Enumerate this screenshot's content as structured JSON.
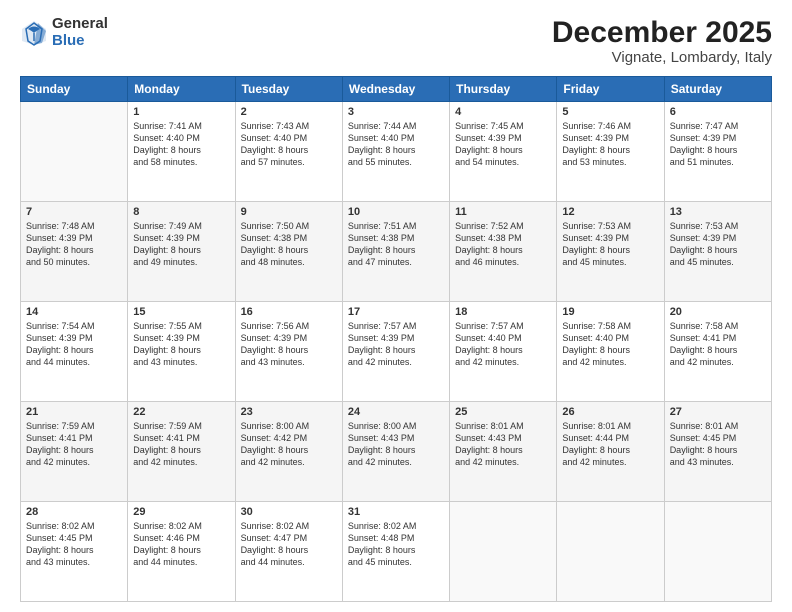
{
  "logo": {
    "general": "General",
    "blue": "Blue"
  },
  "header": {
    "title": "December 2025",
    "subtitle": "Vignate, Lombardy, Italy"
  },
  "weekdays": [
    "Sunday",
    "Monday",
    "Tuesday",
    "Wednesday",
    "Thursday",
    "Friday",
    "Saturday"
  ],
  "weeks": [
    [
      {
        "day": "",
        "info": ""
      },
      {
        "day": "1",
        "info": "Sunrise: 7:41 AM\nSunset: 4:40 PM\nDaylight: 8 hours\nand 58 minutes."
      },
      {
        "day": "2",
        "info": "Sunrise: 7:43 AM\nSunset: 4:40 PM\nDaylight: 8 hours\nand 57 minutes."
      },
      {
        "day": "3",
        "info": "Sunrise: 7:44 AM\nSunset: 4:40 PM\nDaylight: 8 hours\nand 55 minutes."
      },
      {
        "day": "4",
        "info": "Sunrise: 7:45 AM\nSunset: 4:39 PM\nDaylight: 8 hours\nand 54 minutes."
      },
      {
        "day": "5",
        "info": "Sunrise: 7:46 AM\nSunset: 4:39 PM\nDaylight: 8 hours\nand 53 minutes."
      },
      {
        "day": "6",
        "info": "Sunrise: 7:47 AM\nSunset: 4:39 PM\nDaylight: 8 hours\nand 51 minutes."
      }
    ],
    [
      {
        "day": "7",
        "info": "Sunrise: 7:48 AM\nSunset: 4:39 PM\nDaylight: 8 hours\nand 50 minutes."
      },
      {
        "day": "8",
        "info": "Sunrise: 7:49 AM\nSunset: 4:39 PM\nDaylight: 8 hours\nand 49 minutes."
      },
      {
        "day": "9",
        "info": "Sunrise: 7:50 AM\nSunset: 4:38 PM\nDaylight: 8 hours\nand 48 minutes."
      },
      {
        "day": "10",
        "info": "Sunrise: 7:51 AM\nSunset: 4:38 PM\nDaylight: 8 hours\nand 47 minutes."
      },
      {
        "day": "11",
        "info": "Sunrise: 7:52 AM\nSunset: 4:38 PM\nDaylight: 8 hours\nand 46 minutes."
      },
      {
        "day": "12",
        "info": "Sunrise: 7:53 AM\nSunset: 4:39 PM\nDaylight: 8 hours\nand 45 minutes."
      },
      {
        "day": "13",
        "info": "Sunrise: 7:53 AM\nSunset: 4:39 PM\nDaylight: 8 hours\nand 45 minutes."
      }
    ],
    [
      {
        "day": "14",
        "info": "Sunrise: 7:54 AM\nSunset: 4:39 PM\nDaylight: 8 hours\nand 44 minutes."
      },
      {
        "day": "15",
        "info": "Sunrise: 7:55 AM\nSunset: 4:39 PM\nDaylight: 8 hours\nand 43 minutes."
      },
      {
        "day": "16",
        "info": "Sunrise: 7:56 AM\nSunset: 4:39 PM\nDaylight: 8 hours\nand 43 minutes."
      },
      {
        "day": "17",
        "info": "Sunrise: 7:57 AM\nSunset: 4:39 PM\nDaylight: 8 hours\nand 42 minutes."
      },
      {
        "day": "18",
        "info": "Sunrise: 7:57 AM\nSunset: 4:40 PM\nDaylight: 8 hours\nand 42 minutes."
      },
      {
        "day": "19",
        "info": "Sunrise: 7:58 AM\nSunset: 4:40 PM\nDaylight: 8 hours\nand 42 minutes."
      },
      {
        "day": "20",
        "info": "Sunrise: 7:58 AM\nSunset: 4:41 PM\nDaylight: 8 hours\nand 42 minutes."
      }
    ],
    [
      {
        "day": "21",
        "info": "Sunrise: 7:59 AM\nSunset: 4:41 PM\nDaylight: 8 hours\nand 42 minutes."
      },
      {
        "day": "22",
        "info": "Sunrise: 7:59 AM\nSunset: 4:41 PM\nDaylight: 8 hours\nand 42 minutes."
      },
      {
        "day": "23",
        "info": "Sunrise: 8:00 AM\nSunset: 4:42 PM\nDaylight: 8 hours\nand 42 minutes."
      },
      {
        "day": "24",
        "info": "Sunrise: 8:00 AM\nSunset: 4:43 PM\nDaylight: 8 hours\nand 42 minutes."
      },
      {
        "day": "25",
        "info": "Sunrise: 8:01 AM\nSunset: 4:43 PM\nDaylight: 8 hours\nand 42 minutes."
      },
      {
        "day": "26",
        "info": "Sunrise: 8:01 AM\nSunset: 4:44 PM\nDaylight: 8 hours\nand 42 minutes."
      },
      {
        "day": "27",
        "info": "Sunrise: 8:01 AM\nSunset: 4:45 PM\nDaylight: 8 hours\nand 43 minutes."
      }
    ],
    [
      {
        "day": "28",
        "info": "Sunrise: 8:02 AM\nSunset: 4:45 PM\nDaylight: 8 hours\nand 43 minutes."
      },
      {
        "day": "29",
        "info": "Sunrise: 8:02 AM\nSunset: 4:46 PM\nDaylight: 8 hours\nand 44 minutes."
      },
      {
        "day": "30",
        "info": "Sunrise: 8:02 AM\nSunset: 4:47 PM\nDaylight: 8 hours\nand 44 minutes."
      },
      {
        "day": "31",
        "info": "Sunrise: 8:02 AM\nSunset: 4:48 PM\nDaylight: 8 hours\nand 45 minutes."
      },
      {
        "day": "",
        "info": ""
      },
      {
        "day": "",
        "info": ""
      },
      {
        "day": "",
        "info": ""
      }
    ]
  ]
}
